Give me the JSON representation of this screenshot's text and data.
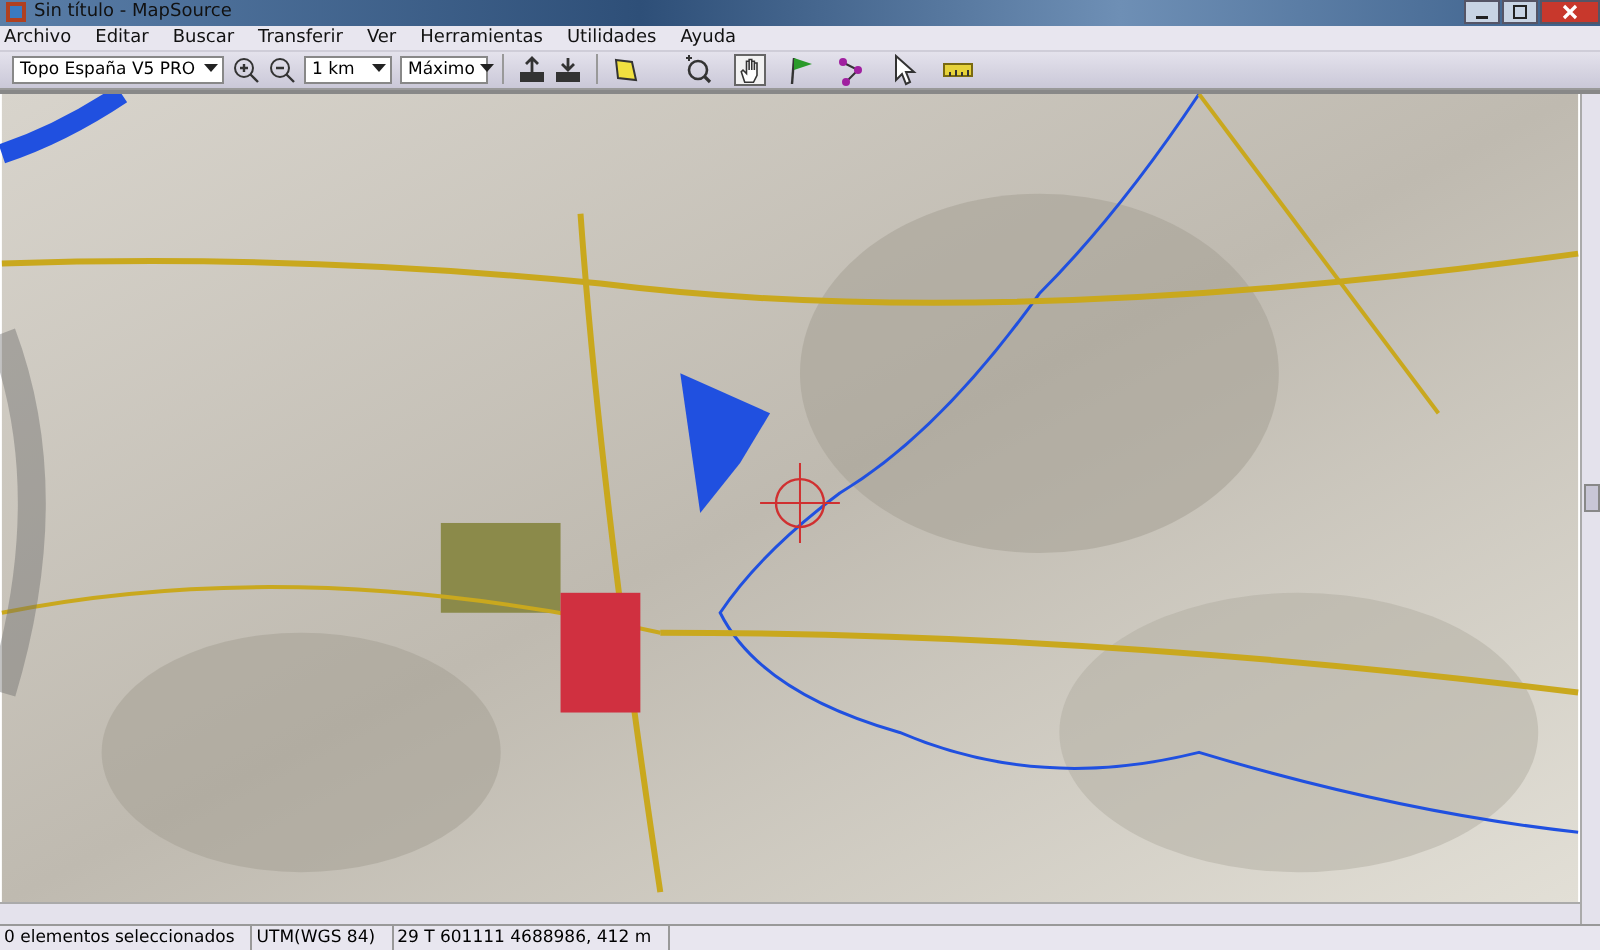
{
  "window": {
    "title": "Sin título - MapSource"
  },
  "menu": [
    "Archivo",
    "Editar",
    "Buscar",
    "Transferir",
    "Ver",
    "Herramientas",
    "Utilidades",
    "Ayuda"
  ],
  "toolbar": {
    "map_product": "Topo España V5 PRO",
    "zoom_scale": "1 km",
    "detail": "Máximo",
    "tools": [
      {
        "kind": "zoom",
        "selected": false
      },
      {
        "kind": "hand",
        "selected": true
      },
      {
        "kind": "waypoint",
        "selected": false
      },
      {
        "kind": "route",
        "selected": false
      },
      {
        "kind": "select",
        "selected": false
      },
      {
        "kind": "distance",
        "selected": false
      }
    ]
  },
  "status_bar": [
    "0 elementos seleccionados",
    "UTM(WGS 84)",
    "29 T 601111 4688986, 412 m"
  ]
}
